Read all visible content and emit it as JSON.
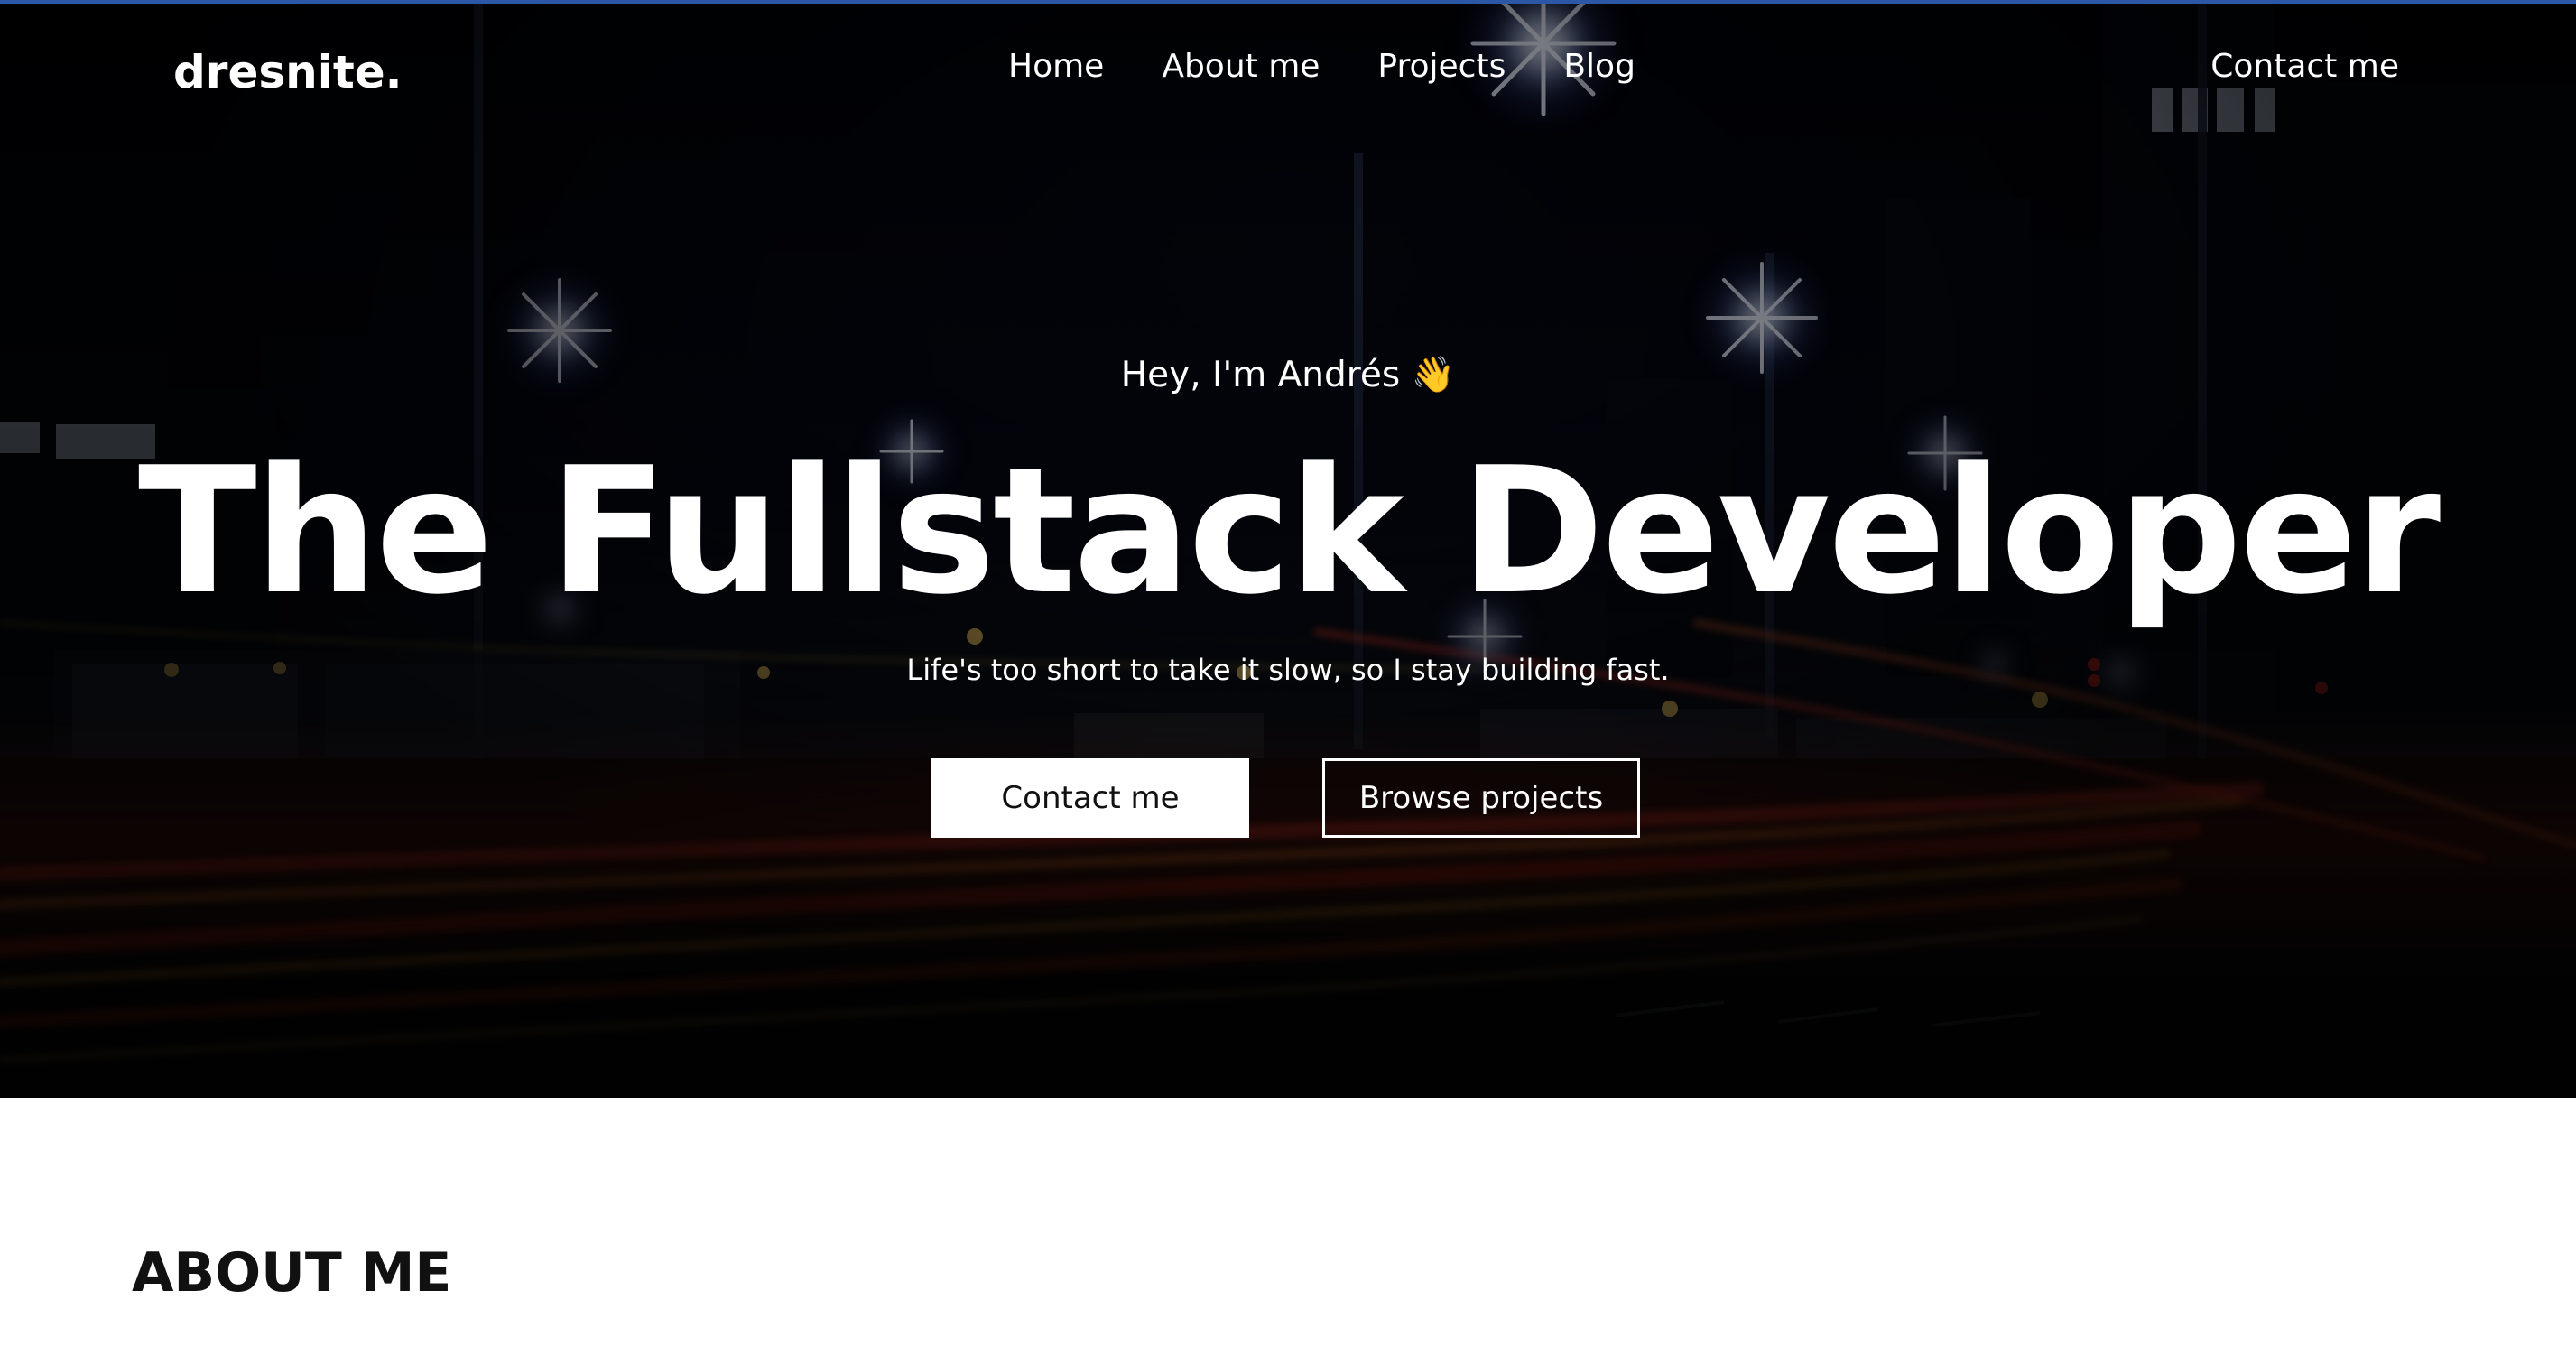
{
  "colors": {
    "accent": "#2c56a6",
    "text_on_dark": "#ffffff",
    "primary_button_bg": "#ffffff",
    "primary_button_text": "#111111",
    "section_bg": "#ffffff",
    "section_title": "#111111"
  },
  "header": {
    "logo": "dresnite.",
    "nav": [
      {
        "label": "Home"
      },
      {
        "label": "About me"
      },
      {
        "label": "Projects"
      },
      {
        "label": "Blog"
      }
    ],
    "contact_label": "Contact me"
  },
  "hero": {
    "greeting": "Hey, I'm Andrés 👋",
    "title": "The Fullstack Developer",
    "tagline": "Life's too short to take it slow, so I stay building fast.",
    "buttons": {
      "primary": "Contact me",
      "secondary": "Browse projects"
    }
  },
  "about": {
    "title": "ABOUT ME"
  }
}
